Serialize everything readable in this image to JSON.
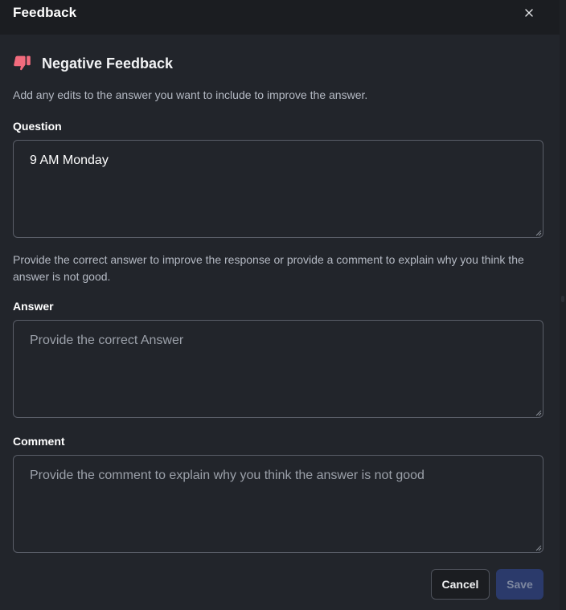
{
  "header": {
    "title": "Feedback",
    "close_icon": "close-icon"
  },
  "feedback": {
    "icon": "thumbs-down-icon",
    "icon_color": "#f26b7d",
    "title": "Negative Feedback",
    "instructions": "Add any edits to the answer you want to include to improve the answer.",
    "answer_instructions": "Provide the correct answer to improve the response or provide a comment to explain why you think the answer is not good."
  },
  "question": {
    "label": "Question",
    "value": "9 AM Monday",
    "placeholder": ""
  },
  "answer": {
    "label": "Answer",
    "value": "",
    "placeholder": "Provide the correct Answer"
  },
  "comment": {
    "label": "Comment",
    "value": "",
    "placeholder": "Provide the comment to explain why you think the answer is not good"
  },
  "footer": {
    "cancel_label": "Cancel",
    "save_label": "Save"
  }
}
